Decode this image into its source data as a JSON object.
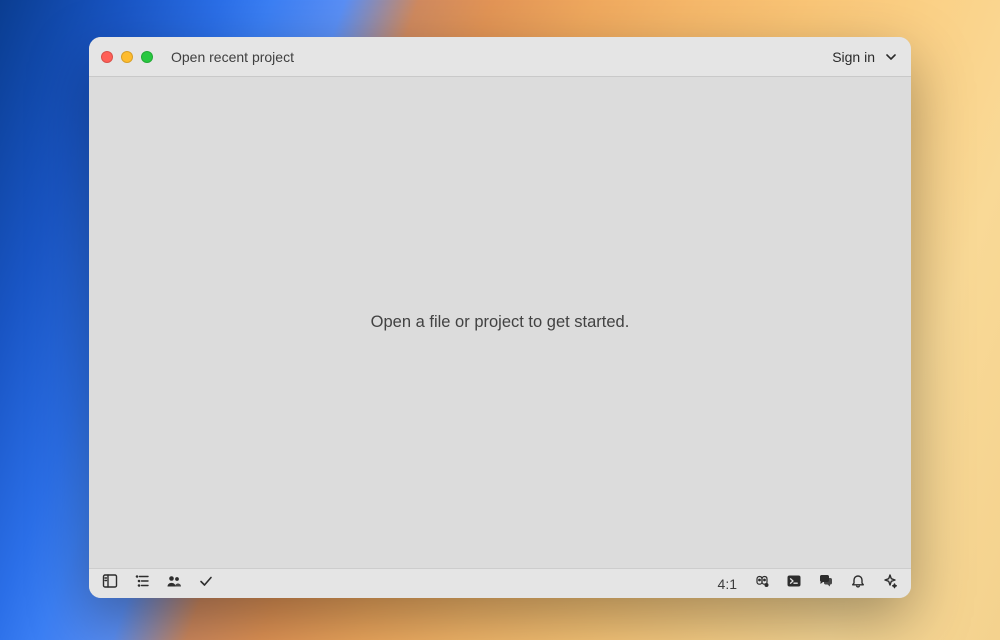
{
  "titlebar": {
    "title": "Open recent project",
    "signin_label": "Sign in"
  },
  "editor": {
    "empty_message": "Open a file or project to get started."
  },
  "statusbar": {
    "cursor_position": "4:1"
  },
  "icons": {
    "close": "close-icon",
    "minimize": "minimize-icon",
    "maximize": "maximize-icon",
    "chevron_down": "chevron-down-icon",
    "project_panel": "project-panel-icon",
    "outline_panel": "outline-panel-icon",
    "collab_panel": "collab-panel-icon",
    "diagnostics": "diagnostics-icon",
    "copilot": "copilot-icon",
    "terminal": "terminal-icon",
    "chat": "chat-icon",
    "notifications": "notifications-icon",
    "assistant": "assistant-icon"
  }
}
